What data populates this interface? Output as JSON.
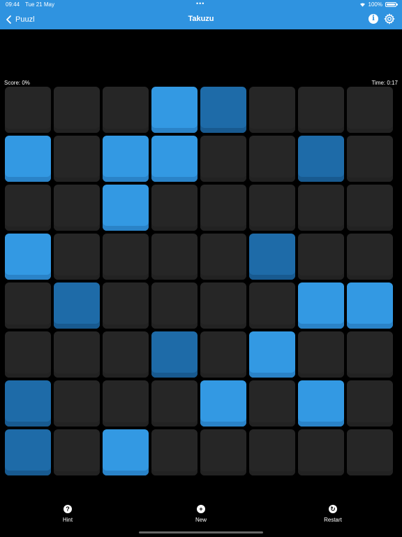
{
  "status_bar": {
    "time": "09:44",
    "date": "Tue 21 May",
    "battery": "100%"
  },
  "nav": {
    "back_label": "Puuzl",
    "title": "Takuzu"
  },
  "game": {
    "score": "Score: 0%",
    "time": "Time: 0:17"
  },
  "board": {
    "size": 8,
    "legend": {
      "0": "empty",
      "1": "light",
      "2": "dark"
    },
    "rows": [
      [
        0,
        0,
        0,
        1,
        2,
        0,
        0,
        0
      ],
      [
        1,
        0,
        1,
        1,
        0,
        0,
        2,
        0
      ],
      [
        0,
        0,
        1,
        0,
        0,
        0,
        0,
        0
      ],
      [
        1,
        0,
        0,
        0,
        0,
        2,
        0,
        0
      ],
      [
        0,
        2,
        0,
        0,
        0,
        0,
        1,
        1
      ],
      [
        0,
        0,
        0,
        2,
        0,
        1,
        0,
        0
      ],
      [
        2,
        0,
        0,
        0,
        1,
        0,
        1,
        0
      ],
      [
        2,
        0,
        1,
        0,
        0,
        0,
        0,
        0
      ]
    ],
    "colors": {
      "empty": "#262626",
      "light": "#3399e3",
      "dark": "#1e6ba8"
    }
  },
  "toolbar": {
    "hint": "Hint",
    "new": "New",
    "restart": "Restart"
  },
  "theme": {
    "accent": "#2f93e0",
    "background": "#000000"
  }
}
